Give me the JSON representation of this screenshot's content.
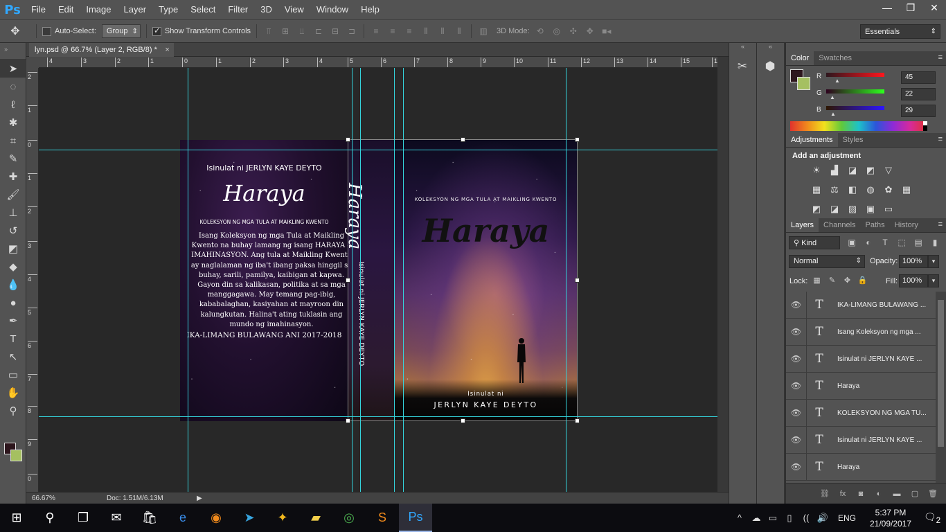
{
  "app": {
    "logo": "Ps"
  },
  "menu": [
    "File",
    "Edit",
    "Image",
    "Layer",
    "Type",
    "Select",
    "Filter",
    "3D",
    "View",
    "Window",
    "Help"
  ],
  "window_controls": [
    "—",
    "❐",
    "✕"
  ],
  "options": {
    "auto_select_label": "Auto-Select:",
    "auto_select_value": "Group",
    "show_transform_label": "Show Transform Controls",
    "mode3d_label": "3D Mode:",
    "workspace": "Essentials"
  },
  "document": {
    "tab_title": "lyn.psd @ 66.7% (Layer 2, RGB/8) *",
    "tab_close": "×"
  },
  "ruler_h": [
    "4",
    "3",
    "2",
    "1",
    "0",
    "1",
    "2",
    "3",
    "4",
    "5",
    "6",
    "7",
    "8",
    "9",
    "10",
    "11",
    "12",
    "13",
    "14",
    "15",
    "16"
  ],
  "ruler_v": [
    "2",
    "1",
    "0",
    "1",
    "2",
    "3",
    "4",
    "5",
    "6",
    "7",
    "8",
    "9",
    "0"
  ],
  "cover": {
    "back_author": "Isinulat ni JERLYN KAYE DEYTO",
    "back_title": "Haraya",
    "back_subtitle": "KOLEKSYON NG MGA TULA AT MAIKLING KWENTO",
    "back_body": "Isang Koleksyon ng mga Tula at Maikling Kwento na buhay lamang ng isang HARAYA o IMAHINASYON. Ang tula at Maikling Kwento ay naglalaman ng iba't ibang paksa hinggil sa buhay, sarili, pamilya, kaibigan at kapwa. Gayon din sa kalikasan, politika at sa mga manggagawa. May temang pag-ibig, kababalaghan, kasiyahan at mayroon din kalungkutan. Halina't ating tuklasin ang mundo ng imahinasyon.",
    "back_award": "IKA-LIMANG BULAWANG ANI 2017-2018",
    "spine_title": "Haraya",
    "spine_author": "Isinulat ni JERLYN KAYE DEYTO",
    "front_subtitle": "KOLEKSYON NG MGA TULA AT MAIKLING KWENTO",
    "front_title": "Haraya",
    "front_by": "Isinulat ni",
    "front_author": "JERLYN KAYE DEYTO"
  },
  "status": {
    "zoom": "66.67%",
    "doc": "Doc: 1.51M/6.13M"
  },
  "color_panel": {
    "tabs": [
      "Color",
      "Swatches"
    ],
    "r_label": "R",
    "r": "45",
    "g_label": "G",
    "g": "22",
    "b_label": "B",
    "b": "29",
    "fg": "#2d161d",
    "bg": "#a5c061"
  },
  "adjustments": {
    "tabs": [
      "Adjustments",
      "Styles"
    ],
    "title": "Add an adjustment"
  },
  "layers": {
    "tabs": [
      "Layers",
      "Channels",
      "Paths",
      "History"
    ],
    "filter": "Kind",
    "blend": "Normal",
    "opacity_label": "Opacity:",
    "opacity": "100%",
    "lock_label": "Lock:",
    "fill_label": "Fill:",
    "fill": "100%",
    "items": [
      {
        "type": "T",
        "name": "IKA-LIMANG BULAWANG ..."
      },
      {
        "type": "T",
        "name": "Isang Koleksyon ng mga ..."
      },
      {
        "type": "T",
        "name": "Isinulat ni JERLYN KAYE ..."
      },
      {
        "type": "T",
        "name": "Haraya"
      },
      {
        "type": "T",
        "name": "KOLEKSYON NG MGA TU..."
      },
      {
        "type": "T",
        "name": "Isinulat ni JERLYN KAYE ..."
      },
      {
        "type": "T",
        "name": "Haraya"
      }
    ]
  },
  "taskbar": {
    "lang": "ENG",
    "time": "5:37 PM",
    "date": "21/09/2017",
    "notif": "2"
  }
}
